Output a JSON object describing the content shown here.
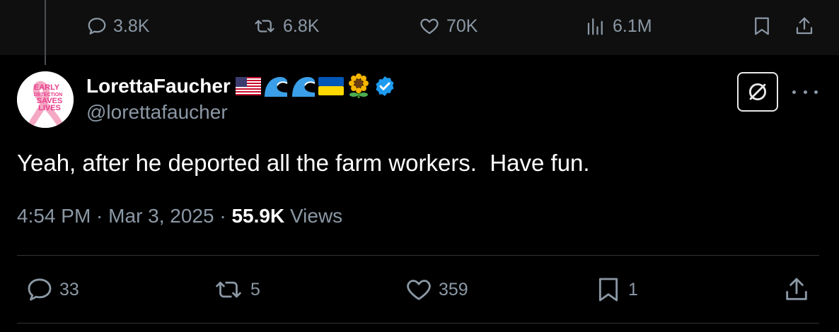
{
  "top_actions": {
    "replies": "3.8K",
    "reposts": "6.8K",
    "likes": "70K",
    "views": "6.1M"
  },
  "tweet": {
    "display_name": "LorettaFaucher",
    "handle": "@lorettafaucher",
    "avatar_text": [
      "EARLY",
      "DETECTION",
      "SAVES",
      "LIVES"
    ],
    "text": "Yeah, after he deported all the farm workers.  Have fun.",
    "time": "4:54 PM",
    "date": "Mar 3, 2025",
    "views_count": "55.9K",
    "views_label": "Views",
    "name_emojis": [
      "us-flag",
      "wave",
      "wave",
      "ukraine-flag",
      "sunflower"
    ],
    "verified": true
  },
  "bottom_actions": {
    "replies": "33",
    "reposts": "5",
    "likes": "359",
    "bookmarks": "1"
  },
  "colors": {
    "background": "#000000",
    "top_strip": "#0f0f0f",
    "text_primary": "#e7e9ea",
    "text_secondary": "#8b98a5",
    "verified_blue": "#1d9bf0",
    "divider": "#2f3336"
  }
}
